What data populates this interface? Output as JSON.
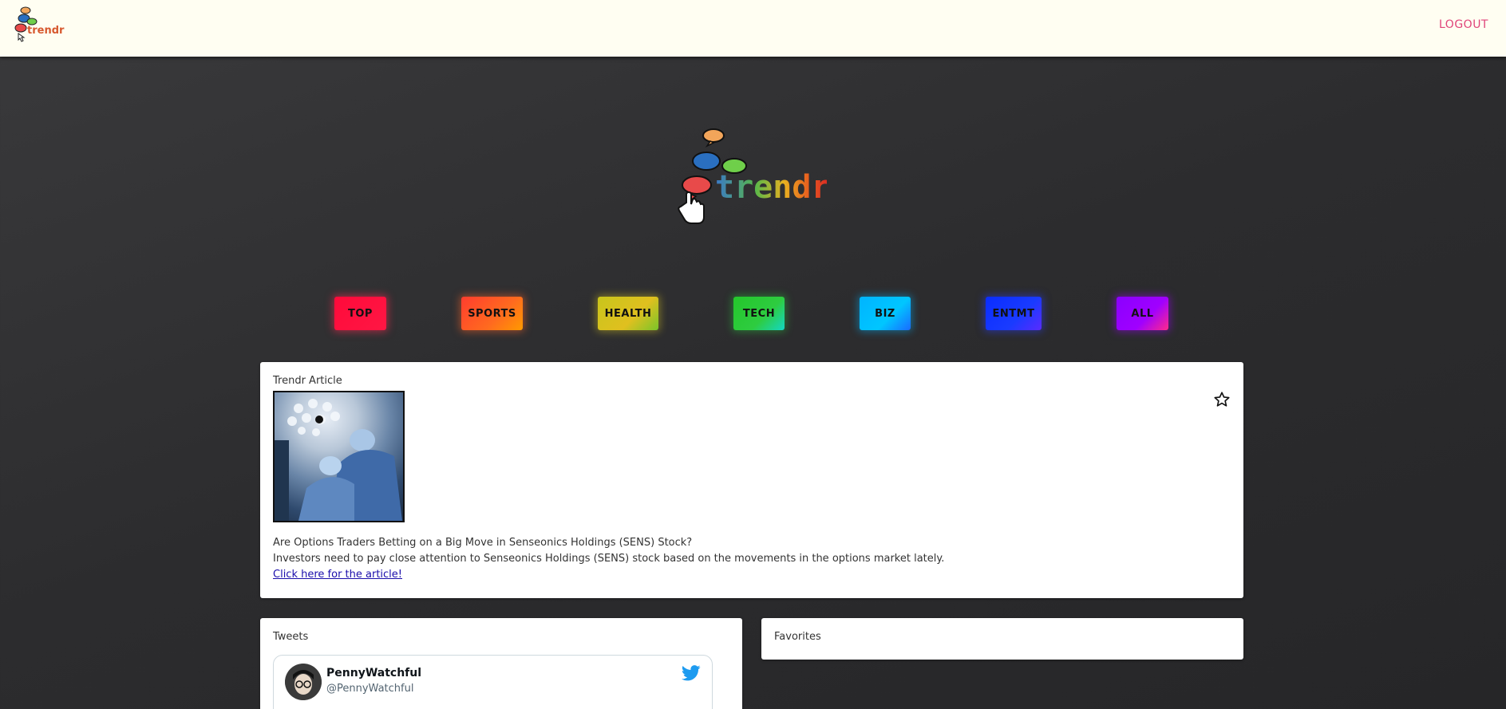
{
  "header": {
    "logo_text": "trendr",
    "logout_label": "LOGOUT"
  },
  "hero": {
    "logo_text": "trendr"
  },
  "categories": [
    {
      "label": "TOP",
      "color": "#ff1744"
    },
    {
      "label": "SPORTS",
      "color": "#ff6a1f"
    },
    {
      "label": "HEALTH",
      "color": "#e0c01f"
    },
    {
      "label": "TECH",
      "color": "#2ecc40"
    },
    {
      "label": "BIZ",
      "color": "#00c6ff"
    },
    {
      "label": "ENTMT",
      "color": "#1a3bff"
    },
    {
      "label": "ALL",
      "color": "#a000ff"
    }
  ],
  "article": {
    "title": "Trendr Article",
    "headline": "Are Options Traders Betting on a Big Move in Senseonics Holdings (SENS) Stock?",
    "summary": "Investors need to pay close attention to Senseonics Holdings (SENS) stock based on the movements in the options market lately.",
    "link_text": "Click here for the article!",
    "favorite_icon": "star-icon"
  },
  "tweets": {
    "title": "Tweets",
    "items": [
      {
        "name": "PennyWatchful",
        "handle": "@PennyWatchful",
        "icon": "twitter-icon"
      }
    ]
  },
  "favorites": {
    "title": "Favorites"
  }
}
